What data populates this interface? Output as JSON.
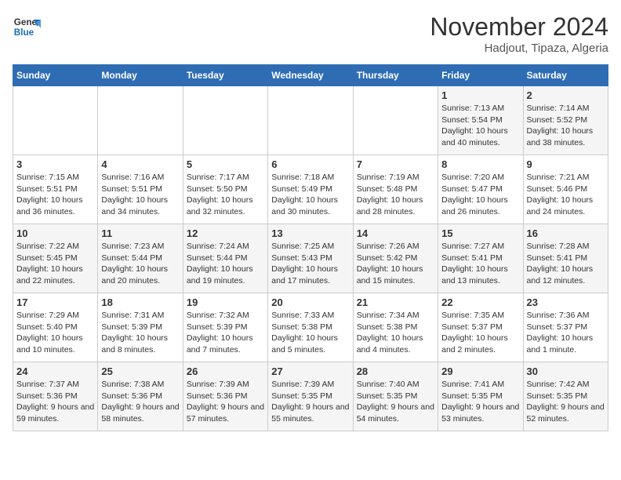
{
  "logo": {
    "line1": "General",
    "line2": "Blue"
  },
  "title": "November 2024",
  "subtitle": "Hadjout, Tipaza, Algeria",
  "weekdays": [
    "Sunday",
    "Monday",
    "Tuesday",
    "Wednesday",
    "Thursday",
    "Friday",
    "Saturday"
  ],
  "weeks": [
    [
      {
        "day": "",
        "info": ""
      },
      {
        "day": "",
        "info": ""
      },
      {
        "day": "",
        "info": ""
      },
      {
        "day": "",
        "info": ""
      },
      {
        "day": "",
        "info": ""
      },
      {
        "day": "1",
        "info": "Sunrise: 7:13 AM\nSunset: 5:54 PM\nDaylight: 10 hours and 40 minutes."
      },
      {
        "day": "2",
        "info": "Sunrise: 7:14 AM\nSunset: 5:52 PM\nDaylight: 10 hours and 38 minutes."
      }
    ],
    [
      {
        "day": "3",
        "info": "Sunrise: 7:15 AM\nSunset: 5:51 PM\nDaylight: 10 hours and 36 minutes."
      },
      {
        "day": "4",
        "info": "Sunrise: 7:16 AM\nSunset: 5:51 PM\nDaylight: 10 hours and 34 minutes."
      },
      {
        "day": "5",
        "info": "Sunrise: 7:17 AM\nSunset: 5:50 PM\nDaylight: 10 hours and 32 minutes."
      },
      {
        "day": "6",
        "info": "Sunrise: 7:18 AM\nSunset: 5:49 PM\nDaylight: 10 hours and 30 minutes."
      },
      {
        "day": "7",
        "info": "Sunrise: 7:19 AM\nSunset: 5:48 PM\nDaylight: 10 hours and 28 minutes."
      },
      {
        "day": "8",
        "info": "Sunrise: 7:20 AM\nSunset: 5:47 PM\nDaylight: 10 hours and 26 minutes."
      },
      {
        "day": "9",
        "info": "Sunrise: 7:21 AM\nSunset: 5:46 PM\nDaylight: 10 hours and 24 minutes."
      }
    ],
    [
      {
        "day": "10",
        "info": "Sunrise: 7:22 AM\nSunset: 5:45 PM\nDaylight: 10 hours and 22 minutes."
      },
      {
        "day": "11",
        "info": "Sunrise: 7:23 AM\nSunset: 5:44 PM\nDaylight: 10 hours and 20 minutes."
      },
      {
        "day": "12",
        "info": "Sunrise: 7:24 AM\nSunset: 5:44 PM\nDaylight: 10 hours and 19 minutes."
      },
      {
        "day": "13",
        "info": "Sunrise: 7:25 AM\nSunset: 5:43 PM\nDaylight: 10 hours and 17 minutes."
      },
      {
        "day": "14",
        "info": "Sunrise: 7:26 AM\nSunset: 5:42 PM\nDaylight: 10 hours and 15 minutes."
      },
      {
        "day": "15",
        "info": "Sunrise: 7:27 AM\nSunset: 5:41 PM\nDaylight: 10 hours and 13 minutes."
      },
      {
        "day": "16",
        "info": "Sunrise: 7:28 AM\nSunset: 5:41 PM\nDaylight: 10 hours and 12 minutes."
      }
    ],
    [
      {
        "day": "17",
        "info": "Sunrise: 7:29 AM\nSunset: 5:40 PM\nDaylight: 10 hours and 10 minutes."
      },
      {
        "day": "18",
        "info": "Sunrise: 7:31 AM\nSunset: 5:39 PM\nDaylight: 10 hours and 8 minutes."
      },
      {
        "day": "19",
        "info": "Sunrise: 7:32 AM\nSunset: 5:39 PM\nDaylight: 10 hours and 7 minutes."
      },
      {
        "day": "20",
        "info": "Sunrise: 7:33 AM\nSunset: 5:38 PM\nDaylight: 10 hours and 5 minutes."
      },
      {
        "day": "21",
        "info": "Sunrise: 7:34 AM\nSunset: 5:38 PM\nDaylight: 10 hours and 4 minutes."
      },
      {
        "day": "22",
        "info": "Sunrise: 7:35 AM\nSunset: 5:37 PM\nDaylight: 10 hours and 2 minutes."
      },
      {
        "day": "23",
        "info": "Sunrise: 7:36 AM\nSunset: 5:37 PM\nDaylight: 10 hours and 1 minute."
      }
    ],
    [
      {
        "day": "24",
        "info": "Sunrise: 7:37 AM\nSunset: 5:36 PM\nDaylight: 9 hours and 59 minutes."
      },
      {
        "day": "25",
        "info": "Sunrise: 7:38 AM\nSunset: 5:36 PM\nDaylight: 9 hours and 58 minutes."
      },
      {
        "day": "26",
        "info": "Sunrise: 7:39 AM\nSunset: 5:36 PM\nDaylight: 9 hours and 57 minutes."
      },
      {
        "day": "27",
        "info": "Sunrise: 7:39 AM\nSunset: 5:35 PM\nDaylight: 9 hours and 55 minutes."
      },
      {
        "day": "28",
        "info": "Sunrise: 7:40 AM\nSunset: 5:35 PM\nDaylight: 9 hours and 54 minutes."
      },
      {
        "day": "29",
        "info": "Sunrise: 7:41 AM\nSunset: 5:35 PM\nDaylight: 9 hours and 53 minutes."
      },
      {
        "day": "30",
        "info": "Sunrise: 7:42 AM\nSunset: 5:35 PM\nDaylight: 9 hours and 52 minutes."
      }
    ]
  ]
}
